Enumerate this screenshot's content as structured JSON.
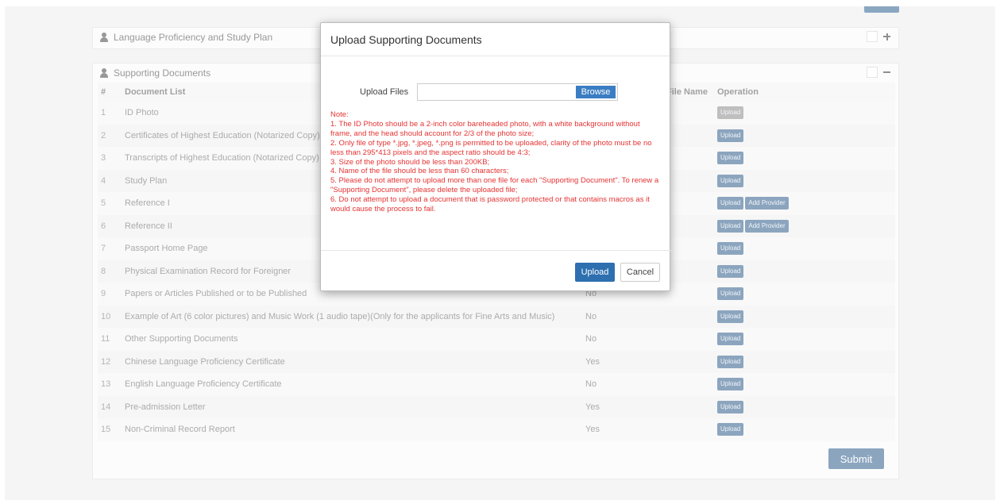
{
  "panels": {
    "language": {
      "title": "Language Proficiency and Study Plan"
    },
    "supporting": {
      "title": "Supporting Documents",
      "columns": {
        "num": "#",
        "list": "Document List",
        "filename": "File Name",
        "op": "Operation"
      }
    }
  },
  "rows": [
    {
      "num": "1",
      "name": "ID Photo",
      "status": "",
      "buttons": [
        "Upload"
      ],
      "disabled": true
    },
    {
      "num": "2",
      "name": "Certificates of Highest Education (Notarized Copy)",
      "status": "",
      "buttons": [
        "Upload"
      ]
    },
    {
      "num": "3",
      "name": "Transcripts of Highest Education (Notarized Copy)",
      "status": "",
      "buttons": [
        "Upload"
      ]
    },
    {
      "num": "4",
      "name": "Study Plan",
      "status": "",
      "buttons": [
        "Upload"
      ]
    },
    {
      "num": "5",
      "name": "Reference I",
      "status": "",
      "buttons": [
        "Upload",
        "Add Provider"
      ]
    },
    {
      "num": "6",
      "name": "Reference II",
      "status": "",
      "buttons": [
        "Upload",
        "Add Provider"
      ]
    },
    {
      "num": "7",
      "name": "Passport Home Page",
      "status": "",
      "buttons": [
        "Upload"
      ]
    },
    {
      "num": "8",
      "name": "Physical Examination Record for Foreigner",
      "status": "",
      "buttons": [
        "Upload"
      ]
    },
    {
      "num": "9",
      "name": "Papers or Articles Published or to be Published",
      "status": "No",
      "buttons": [
        "Upload"
      ]
    },
    {
      "num": "10",
      "name": "Example of Art (6 color pictures) and Music Work (1 audio tape)(Only for the applicants for Fine Arts and Music)",
      "status": "No",
      "buttons": [
        "Upload"
      ]
    },
    {
      "num": "11",
      "name": "Other Supporting Documents",
      "status": "No",
      "buttons": [
        "Upload"
      ]
    },
    {
      "num": "12",
      "name": "Chinese Language Proficiency Certificate",
      "status": "Yes",
      "buttons": [
        "Upload"
      ]
    },
    {
      "num": "13",
      "name": "English Language Proficiency Certificate",
      "status": "No",
      "buttons": [
        "Upload"
      ]
    },
    {
      "num": "14",
      "name": "Pre-admission Letter",
      "status": "Yes",
      "buttons": [
        "Upload"
      ]
    },
    {
      "num": "15",
      "name": "Non-Criminal Record Report",
      "status": "Yes",
      "buttons": [
        "Upload"
      ]
    }
  ],
  "submit_label": "Submit",
  "modal": {
    "title": "Upload Supporting Documents",
    "upload_label": "Upload Files",
    "file_value": "",
    "browse_label": "Browse",
    "note": "Note:\n1. The ID Photo should be a 2-inch color bareheaded photo, with a white background without frame, and the head should account for 2/3 of the photo size;\n2. Only file of type *.jpg, *.jpeg, *.png is permitted to be uploaded, clarity of the photo must be no less than 295*413 pixels and the aspect ratio should be 4:3;\n3. Size of the photo should be less than 200KB;\n4. Name of the file should be less than 60 characters;\n5. Please do not attempt to upload more than one file for each \"Supporting Document\". To renew a \"Supporting Document\", please delete the uploaded file;\n6. Do not attempt to upload a document that is password protected or that contains macros as it would cause the process to fail.",
    "upload_button": "Upload",
    "cancel_button": "Cancel"
  },
  "colors": {
    "primary": "#2e5c8a",
    "note_red": "#e53333",
    "browse_blue": "#3a7dc2"
  }
}
